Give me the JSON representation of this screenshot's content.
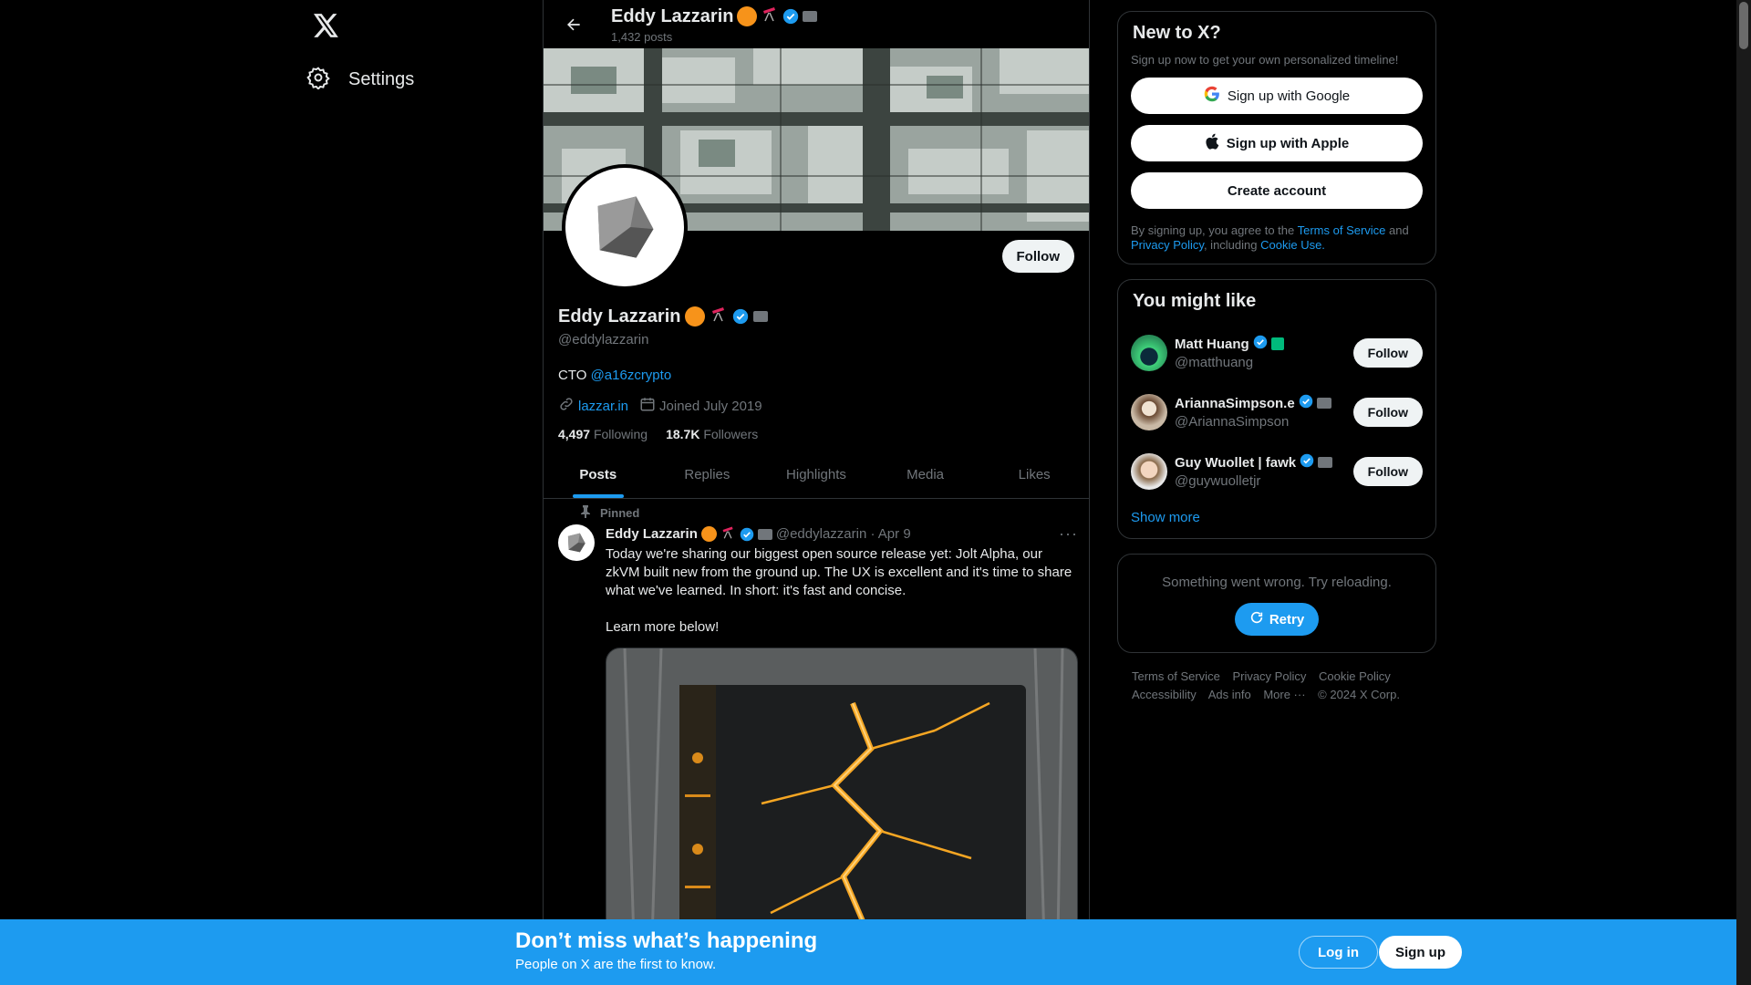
{
  "left_nav": {
    "settings_label": "Settings"
  },
  "header": {
    "name": "Eddy Lazzarin",
    "post_count": "1,432 posts"
  },
  "profile": {
    "follow_label": "Follow",
    "name": "Eddy Lazzarin",
    "handle": "@eddylazzarin",
    "bio_prefix": "CTO ",
    "bio_mention": "@a16zcrypto",
    "website": "lazzar.in",
    "joined": "Joined July 2019",
    "following_count": "4,497",
    "following_label": "Following",
    "followers_count": "18.7K",
    "followers_label": "Followers"
  },
  "tabs": [
    {
      "label": "Posts",
      "active": true
    },
    {
      "label": "Replies",
      "active": false
    },
    {
      "label": "Highlights",
      "active": false
    },
    {
      "label": "Media",
      "active": false
    },
    {
      "label": "Likes",
      "active": false
    }
  ],
  "tweet": {
    "pinned_label": "Pinned",
    "author": "Eddy Lazzarin",
    "meta": "@eddylazzarin · Apr 9",
    "more": "···",
    "text": "Today we're sharing our biggest open source release yet: Jolt Alpha, our zkVM built new from the ground up. The UX is excellent and it's time to share what we've learned. In short: it's fast and concise.\n\nLearn more below!"
  },
  "signup_card": {
    "title": "New to X?",
    "subtitle": "Sign up now to get your own personalized timeline!",
    "google_label": "Sign up with Google",
    "apple_label": "Sign up with Apple",
    "create_label": "Create account",
    "legal_prefix": "By signing up, you agree to the ",
    "tos": "Terms of Service",
    "and": " and ",
    "privacy": "Privacy Policy",
    "including": ", including ",
    "cookie": "Cookie Use."
  },
  "suggestions": {
    "title": "You might like",
    "show_more": "Show more",
    "users": [
      {
        "name": "Matt Huang",
        "handle": "@matthuang",
        "follow": "Follow",
        "avatar_color": "#2a8f5a"
      },
      {
        "name": "AriannaSimpson.e",
        "handle": "@AriannaSimpson",
        "follow": "Follow",
        "avatar_color": "#c9b9a6"
      },
      {
        "name": "Guy Wuollet | fawk",
        "handle": "@guywuolletjr",
        "follow": "Follow",
        "avatar_color": "#d8c4b2"
      }
    ]
  },
  "error_card": {
    "message": "Something went wrong. Try reloading.",
    "retry_label": "Retry"
  },
  "footer": {
    "links": [
      "Terms of Service",
      "Privacy Policy",
      "Cookie Policy",
      "Accessibility",
      "Ads info",
      "More ···",
      "© 2024 X Corp."
    ]
  },
  "bottom_bar": {
    "title": "Don’t miss what’s happening",
    "subtitle": "People on X are the first to know.",
    "login_label": "Log in",
    "signup_label": "Sign up"
  },
  "colors": {
    "accent": "#1d9bf0",
    "background": "#000000",
    "text": "#e7e9ea",
    "muted": "#71767b",
    "border": "#2f3336"
  }
}
